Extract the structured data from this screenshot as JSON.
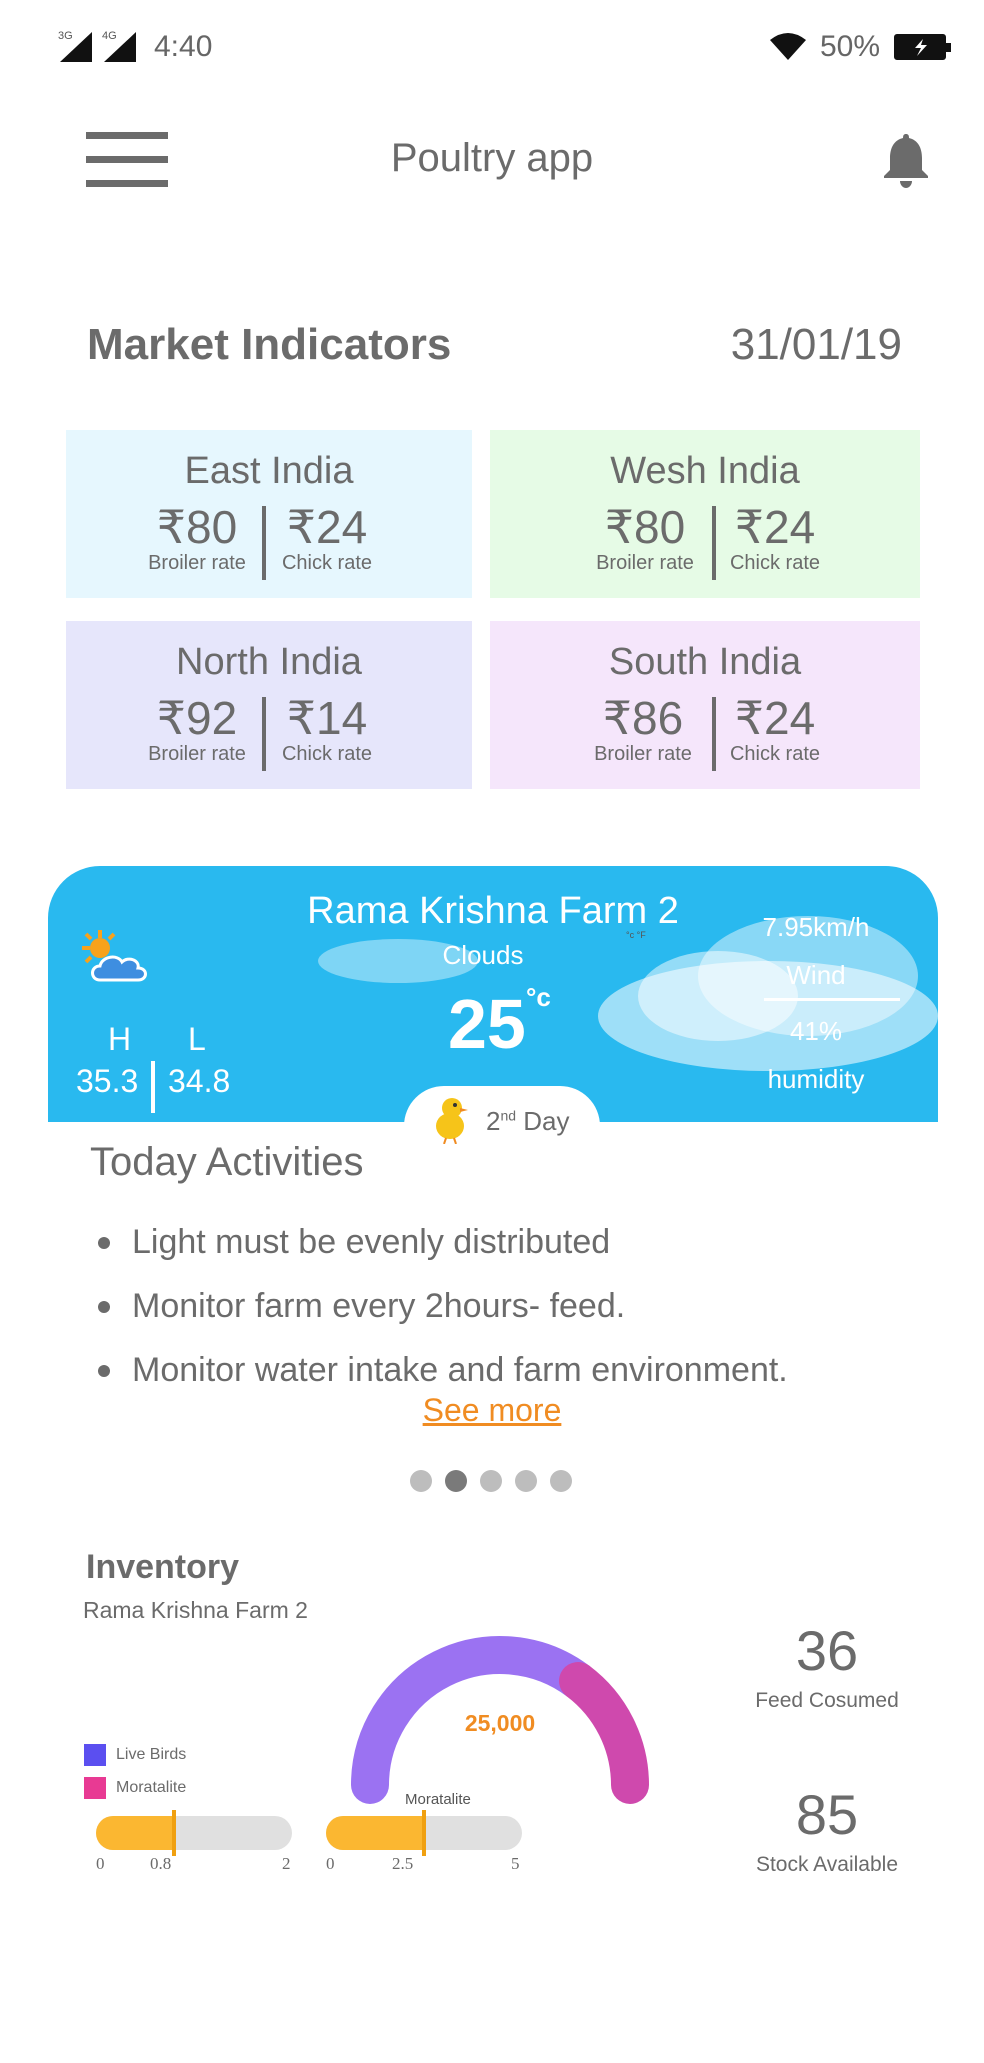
{
  "status_bar": {
    "signal1_tag": "3G",
    "signal2_tag": "4G",
    "time": "4:40",
    "battery": "50%"
  },
  "app_bar": {
    "title": "Poultry app",
    "menu_icon": "hamburger-menu-icon",
    "notification_icon": "bell-icon"
  },
  "market": {
    "title": "Market Indicators",
    "date": "31/01/19",
    "regions": [
      {
        "name": "East India",
        "broiler": "₹80",
        "broiler_label": "Broiler rate",
        "chick": "₹24",
        "chick_label": "Chick rate",
        "bg": "#e6f7fe"
      },
      {
        "name": "Wesh India",
        "broiler": "₹80",
        "broiler_label": "Broiler rate",
        "chick": "₹24",
        "chick_label": "Chick rate",
        "bg": "#e6fbe6"
      },
      {
        "name": "North India",
        "broiler": "₹92",
        "broiler_label": "Broiler rate",
        "chick": "₹14",
        "chick_label": "Chick rate",
        "bg": "#e6e6fb"
      },
      {
        "name": "South India",
        "broiler": "₹86",
        "broiler_label": "Broiler rate",
        "chick": "₹24",
        "chick_label": "Chick rate",
        "bg": "#f5e6fb"
      }
    ]
  },
  "weather": {
    "farm": "Rama Krishna Farm 2",
    "condition": "Clouds",
    "temp": "25",
    "temp_unit": "°c",
    "high_label": "H",
    "low_label": "L",
    "high": "35.3",
    "low": "34.8",
    "wind": "7.95km/h",
    "wind_label": "Wind",
    "humidity": "41%",
    "humidity_label": "humidity",
    "tiny_units": "°c  °F",
    "day": "2",
    "day_suffix": "nd",
    "day_label": "Day",
    "icon": "partly-cloudy-icon",
    "color": "#29b9ef"
  },
  "activities": {
    "title": "Today Activities",
    "items": [
      "Light must be evenly distributed",
      "Monitor farm every 2hours- feed.",
      "Monitor water intake and farm environment."
    ],
    "see_more": "See more",
    "pager_count": 5,
    "pager_active": 1
  },
  "inventory": {
    "title": "Inventory",
    "farm": "Rama Krishna Farm 2",
    "gauge_value": "25,000",
    "legend": [
      {
        "label": "Live Birds",
        "color": "#5b4ff0"
      },
      {
        "label": "Moratalite",
        "color": "#e83a93"
      }
    ],
    "bar1": {
      "min": "0",
      "marker": "0.8",
      "max": "2",
      "value": 0.8,
      "range": 2
    },
    "bar2": {
      "label": "Moratalite",
      "min": "0",
      "marker": "2.5",
      "max": "5",
      "value": 2.5,
      "range": 5
    },
    "feed_consumed": "36",
    "feed_label": "Feed Cosumed",
    "stock": "85",
    "stock_label": "Stock Available"
  }
}
